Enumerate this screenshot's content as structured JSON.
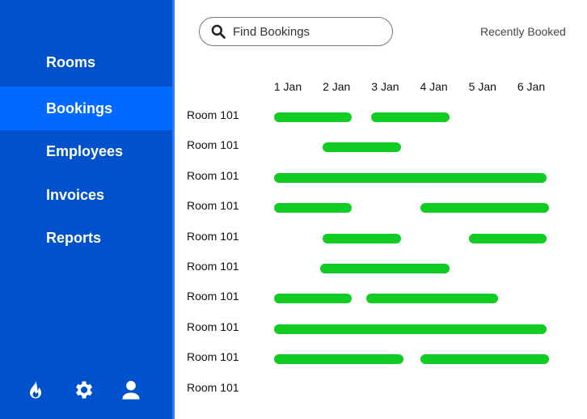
{
  "sidebar": {
    "items": [
      {
        "label": "Rooms",
        "active": false
      },
      {
        "label": "Bookings",
        "active": true
      },
      {
        "label": "Employees",
        "active": false
      },
      {
        "label": "Invoices",
        "active": false
      },
      {
        "label": "Reports",
        "active": false
      }
    ],
    "bottom_icons": [
      "fire-icon",
      "gear-icon",
      "user-icon"
    ]
  },
  "search": {
    "placeholder": "Find Bookings",
    "value": ""
  },
  "recently_booked": "Recently Booked",
  "colors": {
    "sidebar": "#0052cc",
    "active": "#0069ff",
    "bar": "#11cc22"
  },
  "timeline": {
    "days": [
      "1 Jan",
      "2 Jan",
      "3 Jan",
      "4 Jan",
      "5 Jan",
      "6 Jan"
    ],
    "rows": [
      {
        "room": "Room 101",
        "bookings": [
          {
            "start": 1.0,
            "end": 2.6
          },
          {
            "start": 3.0,
            "end": 4.6
          }
        ]
      },
      {
        "room": "Room 101",
        "bookings": [
          {
            "start": 2.0,
            "end": 3.6
          }
        ]
      },
      {
        "room": "Room 101",
        "bookings": [
          {
            "start": 1.0,
            "end": 6.6
          }
        ]
      },
      {
        "room": "Room 101",
        "bookings": [
          {
            "start": 1.0,
            "end": 2.6
          },
          {
            "start": 4.0,
            "end": 6.65
          }
        ]
      },
      {
        "room": "Room 101",
        "bookings": [
          {
            "start": 2.0,
            "end": 3.6
          },
          {
            "start": 5.0,
            "end": 6.6
          }
        ]
      },
      {
        "room": "Room 101",
        "bookings": [
          {
            "start": 1.95,
            "end": 4.6
          }
        ]
      },
      {
        "room": "Room 101",
        "bookings": [
          {
            "start": 1.0,
            "end": 2.6
          },
          {
            "start": 2.9,
            "end": 5.6
          }
        ]
      },
      {
        "room": "Room 101",
        "bookings": [
          {
            "start": 1.0,
            "end": 6.6
          }
        ]
      },
      {
        "room": "Room 101",
        "bookings": [
          {
            "start": 1.0,
            "end": 3.65
          },
          {
            "start": 4.0,
            "end": 6.65
          }
        ]
      },
      {
        "room": "Room 101",
        "bookings": []
      }
    ]
  }
}
